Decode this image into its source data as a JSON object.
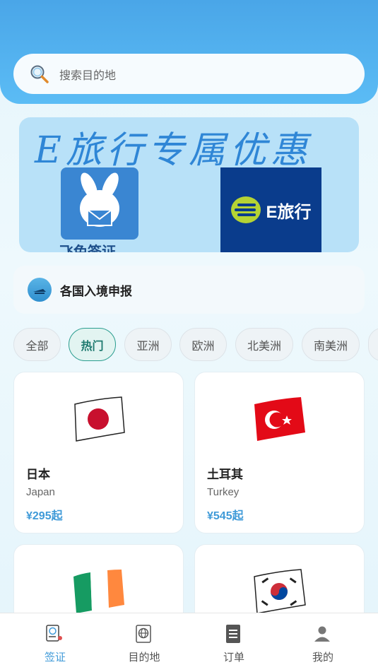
{
  "search": {
    "placeholder": "搜索目的地"
  },
  "banner": {
    "title": "E旅行专属优惠",
    "logo_left_text": "飞兔签证",
    "logo_right_text": "E旅行"
  },
  "entry_report": {
    "label": "各国入境申报"
  },
  "chips": [
    {
      "label": "全部",
      "active": false
    },
    {
      "label": "热门",
      "active": true
    },
    {
      "label": "亚洲",
      "active": false
    },
    {
      "label": "欧洲",
      "active": false
    },
    {
      "label": "北美洲",
      "active": false
    },
    {
      "label": "南美洲",
      "active": false
    }
  ],
  "countries": [
    {
      "name": "日本",
      "en": "Japan",
      "price": "¥295起",
      "flag": "japan-flag-icon"
    },
    {
      "name": "土耳其",
      "en": "Turkey",
      "price": "¥545起",
      "flag": "turkey-flag-icon"
    },
    {
      "name": "",
      "en": "",
      "price": "",
      "flag": "ireland-flag-icon"
    },
    {
      "name": "",
      "en": "",
      "price": "",
      "flag": "south-korea-flag-icon"
    }
  ],
  "tabbar": [
    {
      "label": "签证",
      "icon": "visa-icon",
      "active": true
    },
    {
      "label": "目的地",
      "icon": "globe-icon",
      "active": false
    },
    {
      "label": "订单",
      "icon": "order-icon",
      "active": false
    },
    {
      "label": "我的",
      "icon": "user-icon",
      "active": false
    }
  ],
  "colors": {
    "accent": "#3f9ad8",
    "header": "#4aa6e8",
    "chip_active": "#2a9d8f"
  }
}
